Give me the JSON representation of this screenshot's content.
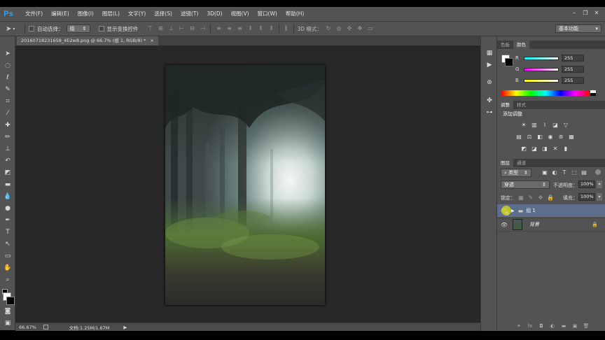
{
  "app": {
    "logo": "Ps",
    "window_buttons": [
      "minimize",
      "restore",
      "close"
    ]
  },
  "menu": [
    "文件(F)",
    "编辑(E)",
    "图像(I)",
    "图层(L)",
    "文字(Y)",
    "选择(S)",
    "滤镜(T)",
    "3D(D)",
    "视图(V)",
    "窗口(W)",
    "帮助(H)"
  ],
  "options": {
    "auto_select_label": "自动选择：",
    "auto_select_value": "组",
    "show_transform_label": "显示变换控件",
    "mode_3d_label": "3D 模式：",
    "workspace": "基本功能"
  },
  "document": {
    "tab_title": "20160718231658_4E2w8.png @ 66.7% (组 1, RGB/8) *",
    "close_glyph": "×"
  },
  "status": {
    "zoom": "66.67%",
    "doc_info": "文档:1.25M/1.67M",
    "arrow": "▶"
  },
  "color_panel": {
    "tabs": [
      "色板",
      "颜色"
    ],
    "active_tab": "颜色",
    "channels": [
      {
        "label": "R",
        "value": "255",
        "gradient": "linear-gradient(to right,#00ffff,#ffffff)"
      },
      {
        "label": "G",
        "value": "255",
        "gradient": "linear-gradient(to right,#ff00ff,#ffffff)"
      },
      {
        "label": "B",
        "value": "255",
        "gradient": "linear-gradient(to right,#ffff00,#ffffff)"
      }
    ]
  },
  "adjust_panel": {
    "tabs": [
      "调整",
      "样式"
    ],
    "active_tab": "调整",
    "heading": "添加调整"
  },
  "layers_panel": {
    "tabs": [
      "图层",
      "通道"
    ],
    "active_tab": "图层",
    "filter_label": "类型",
    "blend_mode": "穿透",
    "opacity_label": "不透明度：",
    "opacity_value": "100%",
    "lock_label": "锁定：",
    "fill_label": "填充：",
    "fill_value": "100%",
    "layers": [
      {
        "name": "组 1",
        "type": "group",
        "selected": true
      },
      {
        "name": "背景",
        "type": "image",
        "selected": false,
        "locked": true
      }
    ]
  },
  "colors": {
    "accent_ps": "#32a3f0",
    "selected_layer": "#5c6e8c",
    "cursor_highlight": "#d4d61a"
  }
}
